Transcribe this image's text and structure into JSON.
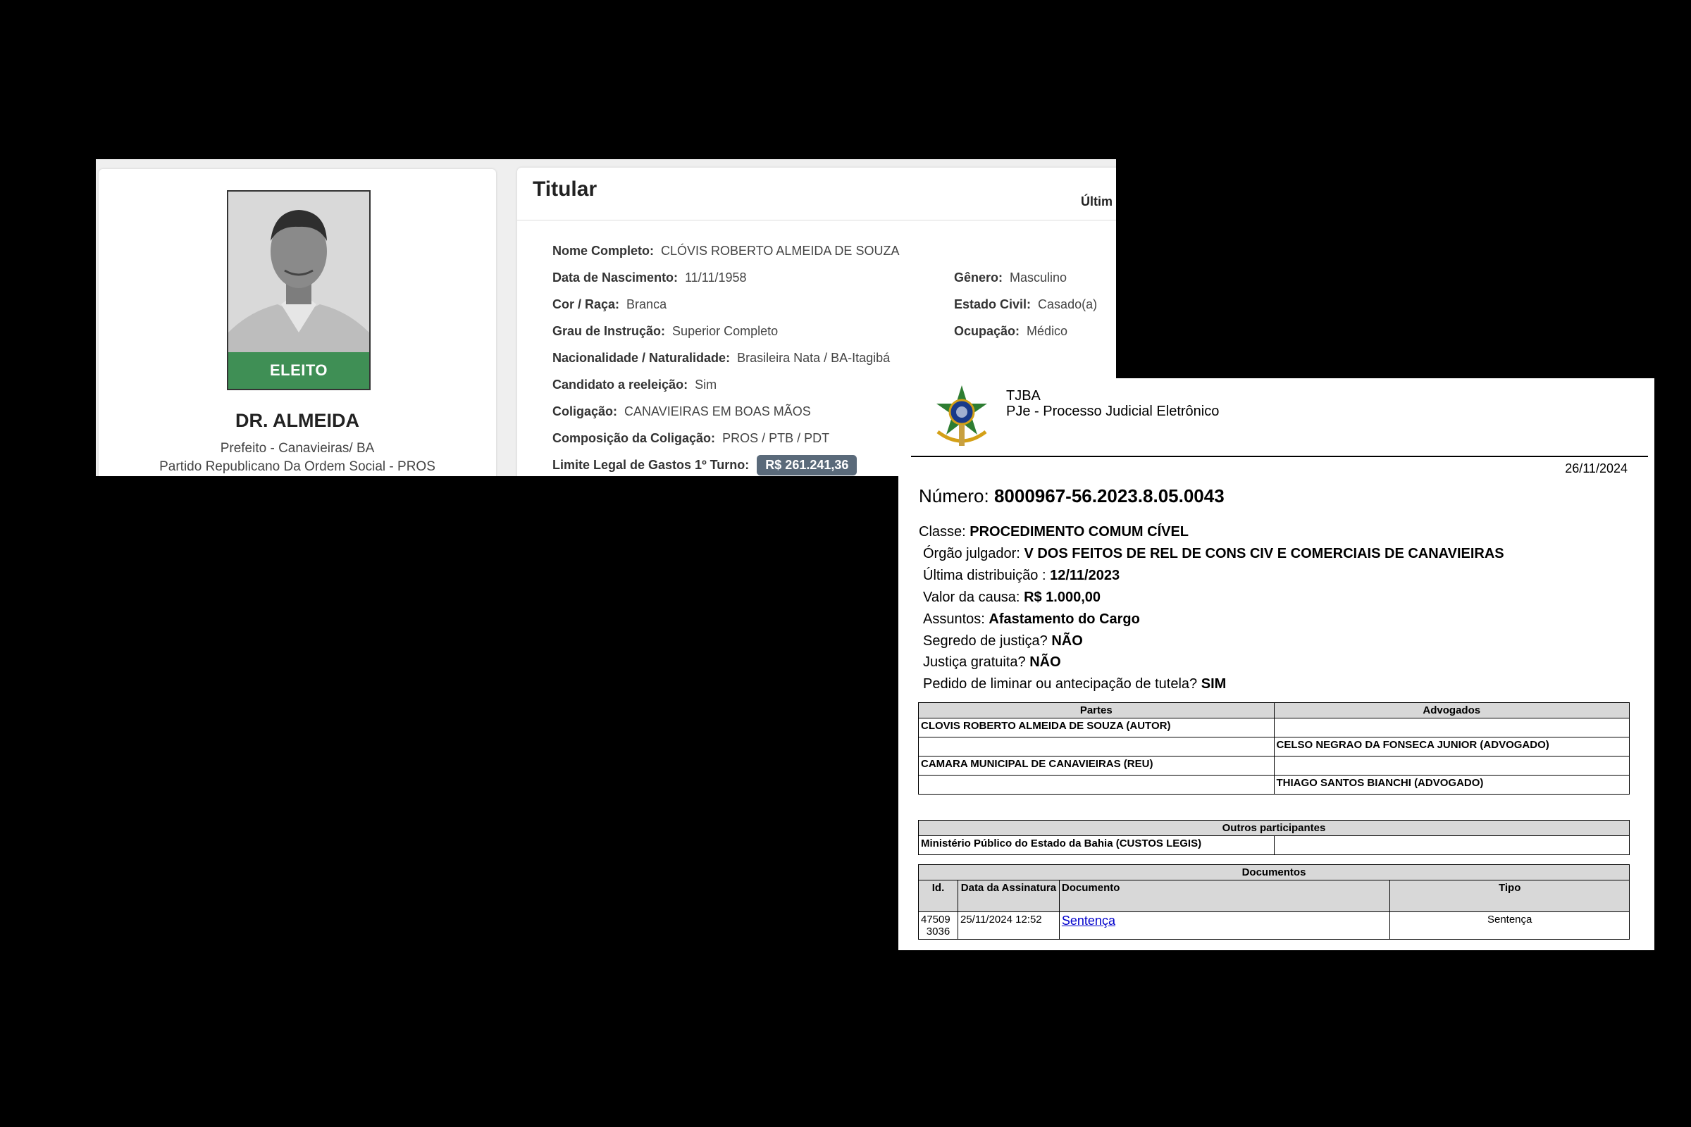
{
  "candidate": {
    "status_badge": "ELEITO",
    "name": "DR. ALMEIDA",
    "role": "Prefeito - Canavieiras/ BA",
    "party": "Partido Republicano Da Ordem Social - PROS",
    "section_title": "Titular",
    "last_update_label": "Últim",
    "fields": {
      "nome_completo": {
        "label": "Nome Completo:",
        "value": "CLÓVIS ROBERTO ALMEIDA DE SOUZA"
      },
      "data_nascimento": {
        "label": "Data de Nascimento:",
        "value": "11/11/1958"
      },
      "cor_raca": {
        "label": "Cor / Raça:",
        "value": "Branca"
      },
      "grau_instrucao": {
        "label": "Grau de Instrução:",
        "value": "Superior Completo"
      },
      "nacionalidade": {
        "label": "Nacionalidade / Naturalidade:",
        "value": "Brasileira Nata / BA-Itagibá"
      },
      "reeleicao": {
        "label": "Candidato a reeleição:",
        "value": "Sim"
      },
      "coligacao": {
        "label": "Coligação:",
        "value": "CANAVIEIRAS EM BOAS MÃOS"
      },
      "composicao": {
        "label": "Composição da Coligação:",
        "value": "PROS / PTB / PDT"
      },
      "limite_gastos": {
        "label": "Limite Legal de Gastos 1º Turno:",
        "value": "R$ 261.241,36"
      },
      "genero": {
        "label": "Gênero:",
        "value": "Masculino"
      },
      "estado_civil": {
        "label": "Estado Civil:",
        "value": "Casado(a)"
      },
      "ocupacao": {
        "label": "Ocupação:",
        "value": "Médico"
      }
    },
    "badge_color": "#3f8f55"
  },
  "court": {
    "org": "TJBA",
    "system": "PJe - Processo Judicial Eletrônico",
    "date": "26/11/2024",
    "numero_label": "Número:",
    "numero": "8000967-56.2023.8.05.0043",
    "lines": {
      "classe": {
        "label": "Classe:",
        "value": "PROCEDIMENTO COMUM CÍVEL"
      },
      "orgao": {
        "label": "Órgão julgador:",
        "value": "V DOS FEITOS DE REL DE CONS CIV E COMERCIAIS DE CANAVIEIRAS"
      },
      "distribuicao": {
        "label": "Última distribuição :",
        "value": "12/11/2023"
      },
      "valor": {
        "label": "Valor da causa:",
        "value": "R$ 1.000,00"
      },
      "assuntos": {
        "label": "Assuntos:",
        "value": "Afastamento do Cargo"
      },
      "segredo": {
        "label": "Segredo de justiça?",
        "value": "NÃO"
      },
      "gratuita": {
        "label": "Justiça gratuita?",
        "value": "NÃO"
      },
      "liminar": {
        "label": "Pedido de liminar ou antecipação de tutela?",
        "value": "SIM"
      }
    },
    "parties_table": {
      "headers": [
        "Partes",
        "Advogados"
      ],
      "rows": [
        [
          "CLOVIS ROBERTO ALMEIDA DE SOUZA (AUTOR)",
          ""
        ],
        [
          "",
          "CELSO NEGRAO DA FONSECA JUNIOR (ADVOGADO)"
        ],
        [
          "CAMARA MUNICIPAL DE CANAVIEIRAS (REU)",
          ""
        ],
        [
          "",
          "THIAGO SANTOS BIANCHI (ADVOGADO)"
        ]
      ]
    },
    "others_table": {
      "header": "Outros participantes",
      "rows": [
        [
          "Ministério Público do Estado da Bahia (CUSTOS LEGIS)",
          ""
        ]
      ]
    },
    "documents_table": {
      "header": "Documentos",
      "columns": [
        "Id.",
        "Data da Assinatura",
        "Documento",
        "Tipo"
      ],
      "rows": [
        {
          "id_line1": "47509",
          "id_line2": "3036",
          "date": "25/11/2024 12:52",
          "doc": "Sentença",
          "tipo": "Sentença"
        }
      ]
    },
    "link_color": "#0000cc"
  }
}
